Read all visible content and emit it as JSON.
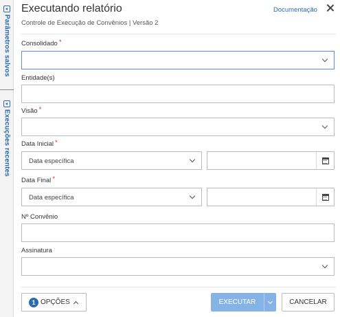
{
  "rail": {
    "saved_params": "Parâmetros salvos",
    "recent_runs": "Execuções recentes"
  },
  "header": {
    "title": "Executando relatório",
    "subtitle": "Controle de Execução de Convênios | Versão 2",
    "doc_link": "Documentação"
  },
  "form": {
    "consolidado": {
      "label": "Consolidado",
      "required": "*",
      "value": ""
    },
    "entidades": {
      "label": "Entidade(s)",
      "value": ""
    },
    "visao": {
      "label": "Visão",
      "required": "*",
      "value": ""
    },
    "data_inicial": {
      "label": "Data Inicial",
      "required": "*",
      "mode": "Data específica",
      "date": ""
    },
    "data_final": {
      "label": "Data Final",
      "required": "*",
      "mode": "Data específica",
      "date": ""
    },
    "convenio": {
      "label": "Nº Convênio",
      "value": ""
    },
    "assinatura": {
      "label": "Assinatura",
      "value": ""
    }
  },
  "footer": {
    "options_count": "1",
    "options_label": "OPÇÕES",
    "execute_label": "EXECUTAR",
    "cancel_label": "CANCELAR"
  },
  "colors": {
    "accent": "#2b6cb0",
    "required": "#d32f2f",
    "execute_bg": "#86b3e6"
  }
}
